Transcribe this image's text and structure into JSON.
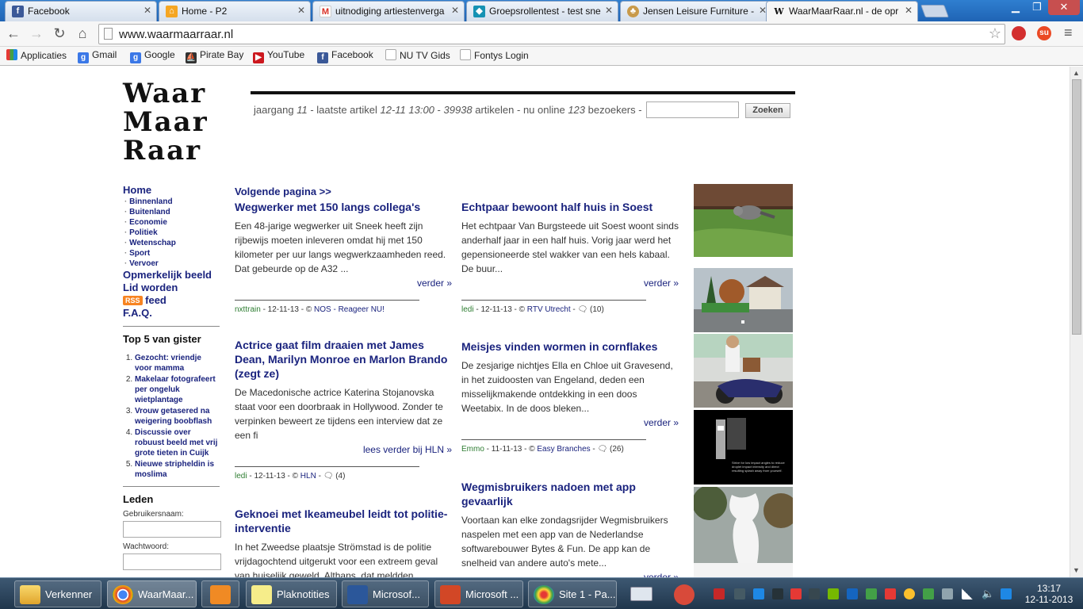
{
  "browser": {
    "tabs": [
      {
        "title": "Facebook",
        "favicon": "facebook-icon"
      },
      {
        "title": "Home - P2",
        "favicon": "home-p2-icon"
      },
      {
        "title": "uitnodiging artiestenverga",
        "favicon": "gmail-icon"
      },
      {
        "title": "Groepsrollentest - test sne",
        "favicon": "cube-icon"
      },
      {
        "title": "Jensen Leisure Furniture -",
        "favicon": "tree-icon"
      },
      {
        "title": "WaarMaarRaar.nl - de opr",
        "favicon": "wmr-icon"
      }
    ],
    "url": "www.waarmaarraar.nl",
    "bookmarks": [
      {
        "label": "Applicaties",
        "icon": "apps-grid-icon",
        "color": "#e53935"
      },
      {
        "label": "Gmail",
        "icon": "google-icon",
        "color": "#3b78e7"
      },
      {
        "label": "Google",
        "icon": "google-icon",
        "color": "#3b78e7"
      },
      {
        "label": "Pirate Bay",
        "icon": "pirate-ship-icon",
        "color": "#333333"
      },
      {
        "label": "YouTube",
        "icon": "youtube-icon",
        "color": "#cc181e"
      },
      {
        "label": "Facebook",
        "icon": "facebook-icon",
        "color": "#3b5998"
      },
      {
        "label": "NU TV Gids",
        "icon": "page-icon",
        "color": "#bbbbbb"
      },
      {
        "label": "Fontys Login",
        "icon": "page-icon",
        "color": "#bbbbbb"
      }
    ]
  },
  "site": {
    "logo": [
      "Waar",
      "Maar",
      "Raar"
    ],
    "stats": {
      "prefix": "jaargang ",
      "year": "11",
      "latest_label": " - laatste artikel ",
      "latest": "12-11 13:00",
      "sep": " - ",
      "count": "39938",
      "count_label": " artikelen - nu online ",
      "online": "123",
      "online_label": " bezoekers - "
    },
    "search_button": "Zoeken",
    "nav": {
      "home": "Home",
      "subs": [
        "Binnenland",
        "Buitenland",
        "Economie",
        "Politiek",
        "Wetenschap",
        "Sport",
        "Vervoer"
      ],
      "opmerkelijk": "Opmerkelijk beeld",
      "lid": "Lid worden",
      "rss_badge": "RSS",
      "feed": "feed",
      "faq": "F.A.Q."
    },
    "top5": {
      "title": "Top 5 van gister",
      "items": [
        "Gezocht: vriendje voor mamma",
        "Makelaar fotografeert per ongeluk wietplantage",
        "Vrouw getasered na weigering boobflash",
        "Discussie over robuust beeld met vrij grote tieten in Cuijk",
        "Nieuwe stripheldin is moslima"
      ]
    },
    "leden": {
      "title": "Leden",
      "user_label": "Gebruikersnaam:",
      "pass_label": "Wachtwoord:"
    },
    "next_page": "Volgende pagina >>",
    "articles": [
      {
        "title": "Wegwerker met 150 langs collega's",
        "text": "Een 48-jarige wegwerker uit Sneek heeft zijn rijbewijs moeten inleveren omdat hij met 150 kilometer per uur langs wegwerkzaamheden reed. Dat gebeurde op de A32 ...",
        "more": "verder »",
        "user": "nxttrain",
        "date": " - 12-11-13 - © ",
        "source": "NOS",
        "extra": " - Reageer NU!",
        "comments": ""
      },
      {
        "title": "Echtpaar bewoont half huis in Soest",
        "text": "Het echtpaar Van Burgsteede uit Soest woont sinds anderhalf jaar in een half huis. Vorig jaar werd het gepensioneerde stel wakker van een hels kabaal. De buur...",
        "more": "verder »",
        "user": "ledi",
        "date": " - 12-11-13 - © ",
        "source": "RTV Utrecht",
        "extra": " - ",
        "comments": "(10)"
      },
      {
        "title": "Actrice gaat film draaien met James Dean, Marilyn Monroe en Marlon Brando (zegt ze)",
        "text": "De Macedonische actrice Katerina Stojanovska staat voor een doorbraak in Hollywood. Zonder te verpinken beweert ze tijdens een interview dat ze een fi",
        "more": "lees verder bij HLN »",
        "user": "ledi",
        "date": " - 12-11-13 - © ",
        "source": "HLN",
        "extra": " - ",
        "comments": "(4)"
      },
      {
        "title": "Meisjes vinden wormen in cornflakes",
        "text": "De zesjarige nichtjes Ella en Chloe uit Gravesend, in het zuidoosten van Engeland, deden een misselijkmakende ontdekking in een doos Weetabix. In de doos bleken...",
        "more": "verder »",
        "user": "Emmo",
        "date": " - 11-11-13 - © ",
        "source": "Easy Branches",
        "extra": " - ",
        "comments": "(26)"
      },
      {
        "title": "Geknoei met Ikeameubel leidt tot politie-interventie",
        "text": "In het Zweedse plaatsje Strömstad is de politie vrijdagochtend uitgerukt voor een extreem geval van huiselijk geweld. Althans, dat meldden",
        "more": "",
        "user": "",
        "date": "",
        "source": "",
        "extra": "",
        "comments": ""
      },
      {
        "title": "Wegmisbruikers nadoen met app gevaarlijk",
        "text": "Voortaan kan elke zondagsrijder Wegmisbruikers naspelen met een app van de Nederlandse softwarebouwer Bytes & Fun. De app kan de snelheid van andere auto's mete...",
        "more": "verder »",
        "user": "",
        "date": "",
        "source": "",
        "extra": "",
        "comments": ""
      }
    ],
    "thumbnails": [
      "raccoon-photo",
      "house-photo",
      "scooter-photo",
      "video-still",
      "statue-photo"
    ],
    "video_caption": "Strive for low impact angles to reduce droplet impact intensity and direct resulting splash away from yourself."
  },
  "taskbar": {
    "items": [
      {
        "label": "Verkenner",
        "icon": "folder-icon"
      },
      {
        "label": "WaarMaar...",
        "icon": "chrome-icon"
      },
      {
        "label": "",
        "icon": "media-player-icon"
      },
      {
        "label": "Plaknotities",
        "icon": "sticky-notes-icon"
      },
      {
        "label": "Microsof...",
        "icon": "word-icon"
      },
      {
        "label": "Microsoft ...",
        "icon": "powerpoint-icon"
      },
      {
        "label": "Site 1 - Pa...",
        "icon": "paint-icon"
      }
    ],
    "time": "13:17",
    "date": "12-11-2013"
  }
}
